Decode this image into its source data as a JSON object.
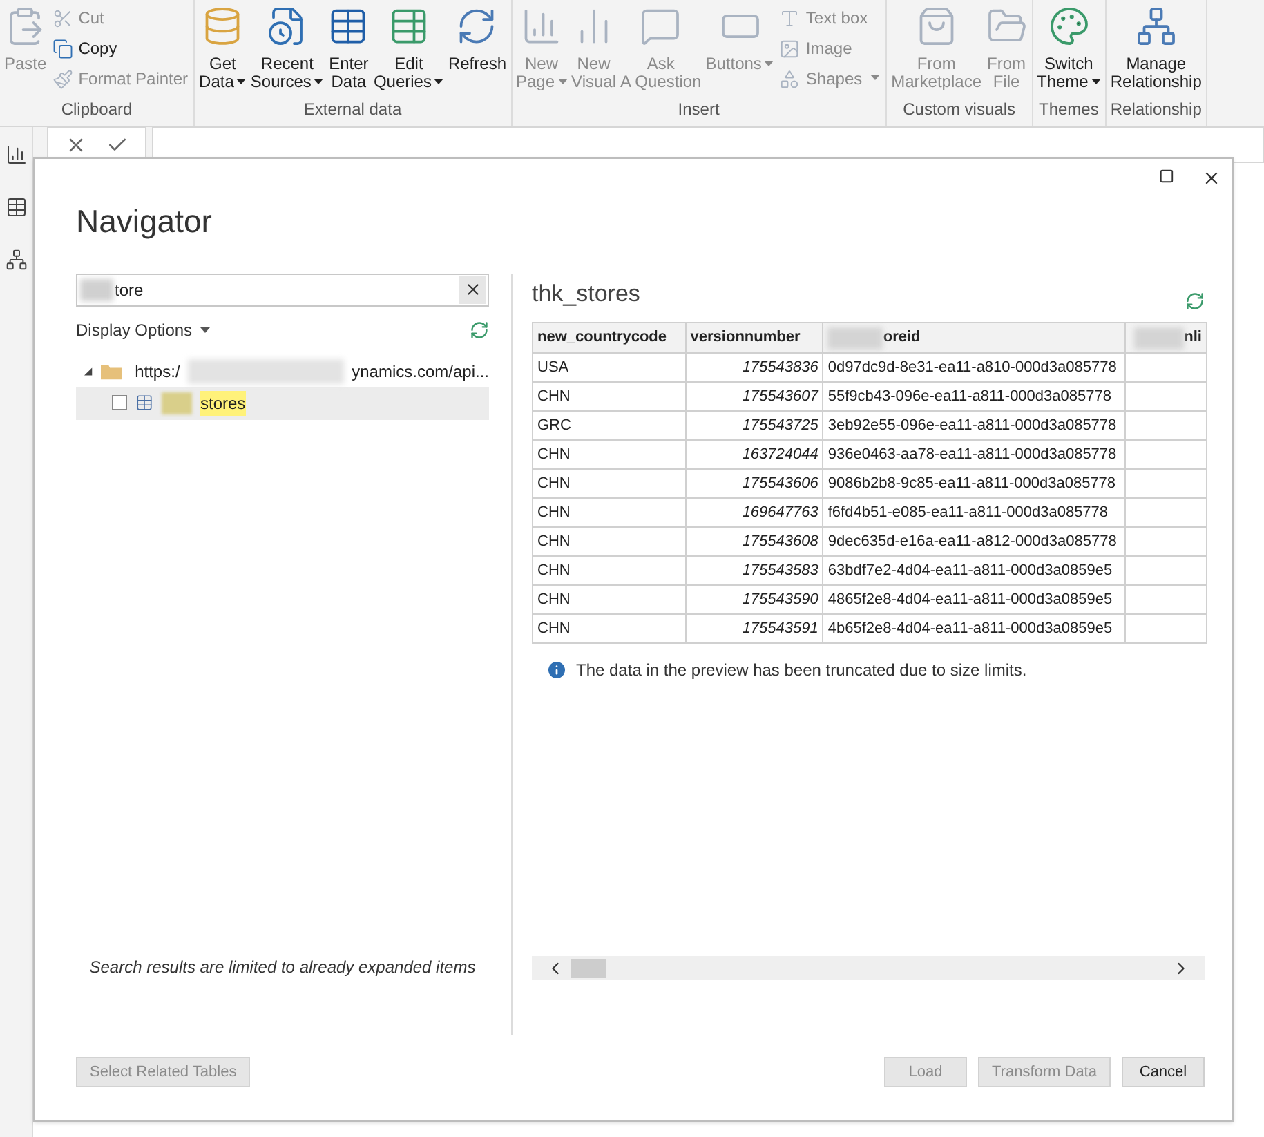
{
  "ribbon": {
    "groups": [
      {
        "label": "Clipboard",
        "items": [
          {
            "label": "Paste",
            "kind": "large",
            "disabled": true,
            "dropdown": false
          },
          {
            "label": "Cut",
            "kind": "small",
            "disabled": true,
            "dropdown": false
          },
          {
            "label": "Copy",
            "kind": "small",
            "disabled": false,
            "dropdown": false
          },
          {
            "label": "Format Painter",
            "kind": "small",
            "disabled": true,
            "dropdown": false
          }
        ]
      },
      {
        "label": "External data",
        "items": [
          {
            "label": "Get Data",
            "kind": "large",
            "disabled": false,
            "dropdown": true
          },
          {
            "label": "Recent Sources",
            "kind": "large",
            "disabled": false,
            "dropdown": true
          },
          {
            "label": "Enter Data",
            "kind": "large",
            "disabled": false,
            "dropdown": false
          },
          {
            "label": "Edit Queries",
            "kind": "large",
            "disabled": false,
            "dropdown": true
          },
          {
            "label": "Refresh",
            "kind": "large",
            "disabled": false,
            "dropdown": false
          }
        ]
      },
      {
        "label": "Insert",
        "items": [
          {
            "label": "New Page",
            "kind": "large",
            "disabled": true,
            "dropdown": true
          },
          {
            "label": "New Visual",
            "kind": "large",
            "disabled": true,
            "dropdown": false
          },
          {
            "label": "Ask A Question",
            "kind": "large",
            "disabled": true,
            "dropdown": false
          },
          {
            "label": "Buttons",
            "kind": "large",
            "disabled": true,
            "dropdown": true
          },
          {
            "label": "Text box",
            "kind": "small",
            "disabled": true,
            "dropdown": false
          },
          {
            "label": "Image",
            "kind": "small",
            "disabled": true,
            "dropdown": false
          },
          {
            "label": "Shapes",
            "kind": "small",
            "disabled": true,
            "dropdown": true
          }
        ]
      },
      {
        "label": "Custom visuals",
        "items": [
          {
            "label": "From Marketplace",
            "kind": "large",
            "disabled": true,
            "dropdown": false
          },
          {
            "label": "From File",
            "kind": "large",
            "disabled": true,
            "dropdown": false
          }
        ]
      },
      {
        "label": "Themes",
        "items": [
          {
            "label": "Switch Theme",
            "kind": "large",
            "disabled": false,
            "dropdown": true
          }
        ]
      },
      {
        "label": "Relationship",
        "items": [
          {
            "label": "Manage Relationship",
            "kind": "large",
            "disabled": false,
            "dropdown": false
          }
        ]
      }
    ]
  },
  "navigator": {
    "title": "Navigator",
    "search": {
      "value": "tore"
    },
    "display_options": "Display Options",
    "tree": [
      {
        "label_start": "https:/",
        "label_end": "ynamics.com/api...",
        "expanded": true,
        "children": [
          {
            "label": "stores",
            "checked": false,
            "selected": true
          }
        ]
      }
    ],
    "note": "Search results are limited to already expanded items",
    "preview": {
      "title": "thk_stores",
      "columns": [
        "new_countrycode",
        "versionnumber",
        "oreid",
        "nli"
      ],
      "rows": [
        [
          "USA",
          "175543836",
          "0d97dc9d-8e31-ea11-a810-000d3a085778"
        ],
        [
          "CHN",
          "175543607",
          "55f9cb43-096e-ea11-a811-000d3a085778"
        ],
        [
          "GRC",
          "175543725",
          "3eb92e55-096e-ea11-a811-000d3a085778"
        ],
        [
          "CHN",
          "163724044",
          "936e0463-aa78-ea11-a811-000d3a085778"
        ],
        [
          "CHN",
          "175543606",
          "9086b2b8-9c85-ea11-a811-000d3a085778"
        ],
        [
          "CHN",
          "169647763",
          "f6fd4b51-e085-ea11-a811-000d3a085778"
        ],
        [
          "CHN",
          "175543608",
          "9dec635d-e16a-ea11-a812-000d3a085778"
        ],
        [
          "CHN",
          "175543583",
          "63bdf7e2-4d04-ea11-a811-000d3a0859e5"
        ],
        [
          "CHN",
          "175543590",
          "4865f2e8-4d04-ea11-a811-000d3a0859e5"
        ],
        [
          "CHN",
          "175543591",
          "4b65f2e8-4d04-ea11-a811-000d3a0859e5"
        ]
      ],
      "message": "The data in the preview has been truncated due to size limits."
    },
    "buttons": [
      {
        "label": "Select Related Tables",
        "disabled": true
      },
      {
        "label": "Load",
        "disabled": true
      },
      {
        "label": "Transform Data",
        "disabled": true
      },
      {
        "label": "Cancel",
        "disabled": false
      }
    ]
  }
}
